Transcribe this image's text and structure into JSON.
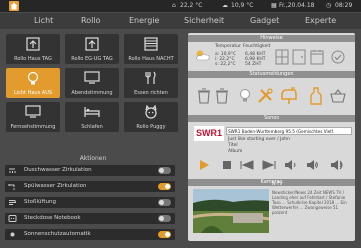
{
  "status": {
    "temp_in": "22,2 °C",
    "temp_out": "10,9 °C",
    "date": "Fr.,20.04.18",
    "time": "08:29"
  },
  "nav": [
    "Licht",
    "Rollo",
    "Energie",
    "Sicherheit",
    "Gadget",
    "Experte"
  ],
  "tiles": [
    {
      "label": "Rollo Haus TAG",
      "icon": "blinds-up-icon",
      "active": false
    },
    {
      "label": "Rollo EG-UG TAG",
      "icon": "blinds-up-icon",
      "active": false
    },
    {
      "label": "Rollo Haus NACHT",
      "icon": "blinds-down-icon",
      "active": false
    },
    {
      "label": "Licht Haus AUS",
      "icon": "lightbulb-icon",
      "active": true
    },
    {
      "label": "Abendstimmung",
      "icon": "tv-icon",
      "active": false
    },
    {
      "label": "Essen richten",
      "icon": "cutlery-icon",
      "active": false
    },
    {
      "label": "Fernsehstimmung",
      "icon": "monitor-icon",
      "active": false
    },
    {
      "label": "Schlafen",
      "icon": "bed-icon",
      "active": false
    },
    {
      "label": "Rollo Puggy",
      "icon": "dog-icon",
      "active": false
    }
  ],
  "actions_title": "Aktionen",
  "actions": [
    {
      "label": "Duschwasser Zirkulation",
      "icon": "shower-icon",
      "on": false
    },
    {
      "label": "Spülwasser Zirkulation",
      "icon": "faucet-icon",
      "on": true
    },
    {
      "label": "Stoßlüftung",
      "icon": "fan-icon",
      "on": false
    },
    {
      "label": "Steckdose Notebook",
      "icon": "socket-icon",
      "on": false
    },
    {
      "label": "Sonnenschutzautomatik",
      "icon": "sun-icon",
      "on": true
    }
  ],
  "hinweise": {
    "title": "Hinweise",
    "col1": "Temperatur",
    "col2": "Feuchtigkeit",
    "temps": [
      "a: 10,9°C",
      "i: 22,2°C",
      "s: 22,2°C"
    ],
    "hums": [
      "6,48 KHT",
      "6,98 KHT",
      "54 ZHT"
    ]
  },
  "status_section": {
    "title": "Statusmeldungen"
  },
  "sonos": {
    "title": "Sonos",
    "station": "SWR1 Baden-Wurttemberg 95.5 (Gemischtes Vielf.",
    "line2": "Just like starting over / John",
    "line3": "Titel",
    "line4": "Album"
  },
  "cameras": {
    "title": "Kameras",
    "news_title": "N-TV",
    "news": "Newsticker/News 24 Zeit NEWS TV / Landing eher auf Fehlstart / Stefanie Toso ... Schulkrise Kapitel 2018 ... Ein Wetterwerfer ... Zwangsweise 51 prozent"
  },
  "colors": {
    "accent": "#e39b2e",
    "bg": "#4b4b4b",
    "tile": "#333333",
    "panel": "#d9d9d9"
  }
}
